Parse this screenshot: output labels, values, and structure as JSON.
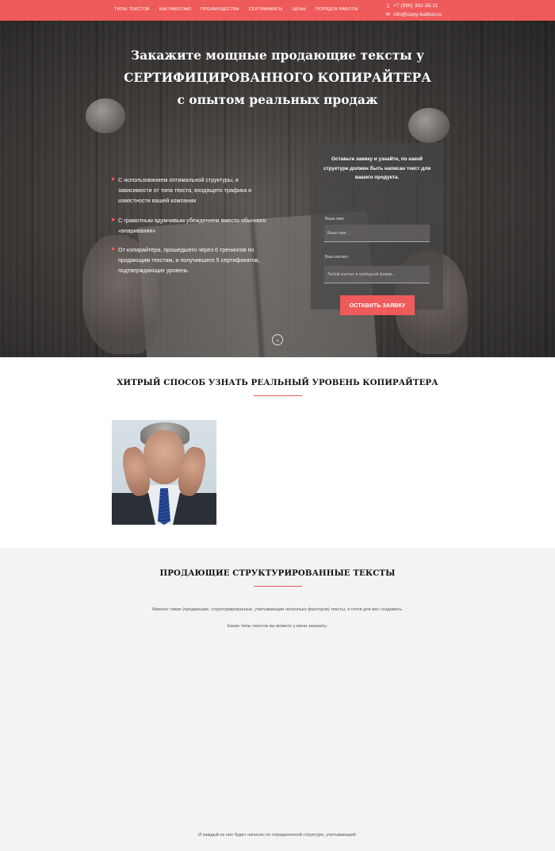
{
  "nav": {
    "items": [
      "ТИПЫ ТЕКСТОВ",
      "КАК РАБОТАЮ",
      "ПРЕИМУЩЕСТВА",
      "СЕРТИФИКАТЫ",
      "ЦЕНЫ",
      "ПОРЯДОК РАБОТЫ"
    ],
    "phone": "+7 (990) 392-35-11",
    "email": "info@copy-kulikov.ru"
  },
  "hero": {
    "title_line1": "Закажите мощные продающие тексты у",
    "title_line2": "СЕРТИФИЦИРОВАННОГО КОПИРАЙТЕРА",
    "title_line3": "с опытом реальных продаж",
    "features": [
      "С использованием оптимальной структуры, в зависимости от типа текста, входящего трафика и известности вашей компании",
      "С грамотным вдумчивым убеждением вместо обычного «впаривания»",
      "От копирайтера, прошедшего через 6 тренингов по продающим текстам, и получившего 5 сертификатов, подтверждающих уровень"
    ],
    "form": {
      "lead": "Оставьте заявку и узнайте, по какой структуре должен быть написан текст для вашего продукта.",
      "name_label": "Ваше имя:",
      "name_placeholder": "Ваше имя...",
      "contact_label": "Ваш контакт:",
      "contact_placeholder": "Любой контакт в свободной форме...",
      "submit": "ОСТАВИТЬ ЗАЯВКУ"
    }
  },
  "section1": {
    "title": "ХИТРЫЙ СПОСОБ УЗНАТЬ РЕАЛЬНЫЙ УРОВЕНЬ КОПИРАЙТЕРА"
  },
  "section2": {
    "title": "ПРОДАЮЩИЕ СТРУКТУРИРОВАННЫЕ ТЕКСТЫ",
    "para1": "Именно такие (продающие, структурированные, учитывающие несколько факторов) тексты, я готов для вас создавать.",
    "para2": "Какие типы текстов вы можете у меня заказать:",
    "para3": "И каждый из них будет написан по определенной структуре, учитывающей:"
  },
  "colors": {
    "accent": "#ef5a5a",
    "hero_bg": "#3d3a38"
  }
}
